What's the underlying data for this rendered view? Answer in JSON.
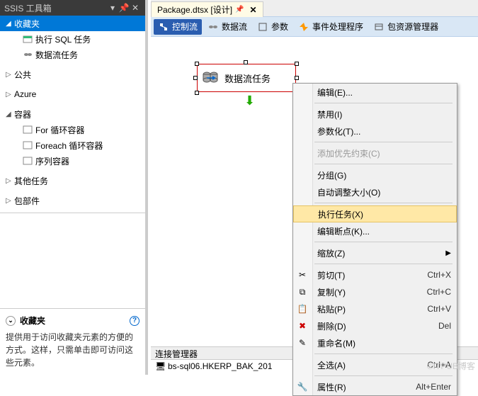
{
  "left_panel": {
    "title": "SSIS 工具箱",
    "tree": {
      "favorites": {
        "label": "收藏夹",
        "expanded": true,
        "items": [
          {
            "id": "exec-sql",
            "label": "执行 SQL 任务"
          },
          {
            "id": "dataflow",
            "label": "数据流任务"
          }
        ]
      },
      "groups": [
        {
          "id": "common",
          "label": "公共",
          "expanded": false
        },
        {
          "id": "azure",
          "label": "Azure",
          "expanded": false
        },
        {
          "id": "containers",
          "label": "容器",
          "expanded": true,
          "items": [
            {
              "id": "for-loop",
              "label": "For 循环容器"
            },
            {
              "id": "foreach-loop",
              "label": "Foreach 循环容器"
            },
            {
              "id": "sequence",
              "label": "序列容器"
            }
          ]
        },
        {
          "id": "other-tasks",
          "label": "其他任务",
          "expanded": false
        },
        {
          "id": "packages",
          "label": "包部件",
          "expanded": false
        }
      ]
    },
    "fav_section": {
      "title": "收藏夹",
      "desc": "提供用于访问收藏夹元素的方便的方式。这样，只需单击即可访问这些元素。"
    }
  },
  "tabs": {
    "active": {
      "label": "Package.dtsx [设计]"
    }
  },
  "toolbar": [
    {
      "id": "control-flow",
      "label": "控制流",
      "active": true
    },
    {
      "id": "data-flow",
      "label": "数据流"
    },
    {
      "id": "parameters",
      "label": "参数"
    },
    {
      "id": "event-handlers",
      "label": "事件处理程序"
    },
    {
      "id": "package-explorer",
      "label": "包资源管理器"
    }
  ],
  "canvas": {
    "task": {
      "label": "数据流任务"
    }
  },
  "conn_panel": {
    "title": "连接管理器",
    "item": "bs-sql06.HKERP_BAK_201"
  },
  "context_menu": [
    {
      "id": "edit",
      "label": "编辑(E)...",
      "icon": ""
    },
    {
      "type": "sep"
    },
    {
      "id": "disable",
      "label": "禁用(I)"
    },
    {
      "id": "parameterize",
      "label": "参数化(T)..."
    },
    {
      "type": "sep"
    },
    {
      "id": "add-constraint",
      "label": "添加优先约束(C)",
      "disabled": true
    },
    {
      "type": "sep"
    },
    {
      "id": "group",
      "label": "分组(G)"
    },
    {
      "id": "autosize",
      "label": "自动调整大小(O)"
    },
    {
      "type": "sep"
    },
    {
      "id": "execute-task",
      "label": "执行任务(X)",
      "highlighted": true
    },
    {
      "id": "edit-breakpoint",
      "label": "编辑断点(K)..."
    },
    {
      "type": "sep"
    },
    {
      "id": "zoom",
      "label": "缩放(Z)",
      "submenu": true
    },
    {
      "type": "sep"
    },
    {
      "id": "cut",
      "label": "剪切(T)",
      "icon": "cut",
      "shortcut": "Ctrl+X"
    },
    {
      "id": "copy",
      "label": "复制(Y)",
      "icon": "copy",
      "shortcut": "Ctrl+C"
    },
    {
      "id": "paste",
      "label": "粘贴(P)",
      "icon": "paste",
      "shortcut": "Ctrl+V"
    },
    {
      "id": "delete",
      "label": "删除(D)",
      "icon": "delete",
      "shortcut": "Del"
    },
    {
      "id": "rename",
      "label": "重命名(M)",
      "icon": "rename"
    },
    {
      "type": "sep"
    },
    {
      "id": "select-all",
      "label": "全选(A)",
      "shortcut": "Ctrl+A"
    },
    {
      "type": "sep"
    },
    {
      "id": "properties",
      "label": "属性(R)",
      "icon": "props",
      "shortcut": "Alt+Enter"
    }
  ],
  "watermark": "©ITPUB博客"
}
